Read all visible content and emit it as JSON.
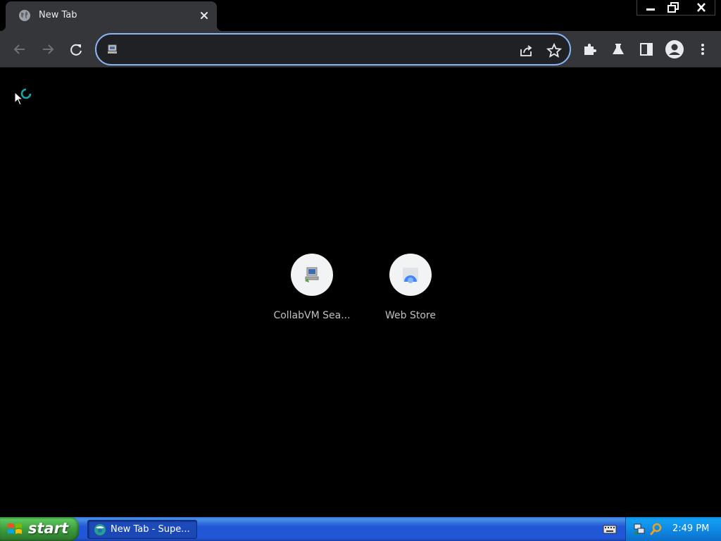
{
  "browser": {
    "tab": {
      "title": "New Tab",
      "favicon": "globe-icon",
      "close_icon": "close-icon"
    },
    "window_controls": [
      "minimize-icon",
      "restore-icon",
      "close-icon"
    ],
    "toolbar": {
      "back_icon": "back-arrow-icon",
      "forward_icon": "forward-arrow-icon",
      "reload_icon": "reload-icon",
      "omnibox": {
        "value": "",
        "placeholder": "",
        "site_icon": "collabvm-icon",
        "share_icon": "share-icon",
        "bookmark_icon": "star-icon"
      },
      "extensions_icon": "puzzle-icon",
      "labs_icon": "flask-icon",
      "side_panel_icon": "side-panel-icon",
      "profile_icon": "profile-avatar-icon",
      "menu_icon": "kebab-menu-icon"
    },
    "accent_color": "#8ab4f8"
  },
  "page": {
    "loading_indicator": "spinner-icon",
    "shortcuts": [
      {
        "label": "CollabVM Sea...",
        "icon": "collabvm-computer-icon"
      },
      {
        "label": "Web Store",
        "icon": "chrome-webstore-icon"
      }
    ]
  },
  "taskbar": {
    "start_label": "start",
    "tasks": [
      {
        "label": "New Tab - Supe...",
        "icon": "browser-icon"
      }
    ],
    "tray": {
      "icons": [
        "network-icon",
        "search-icon"
      ],
      "clock": "2:49 PM"
    },
    "colors": {
      "taskbar": "#2157d7",
      "start_button": "#3d9d3d",
      "tray": "#0f8ae6"
    }
  }
}
